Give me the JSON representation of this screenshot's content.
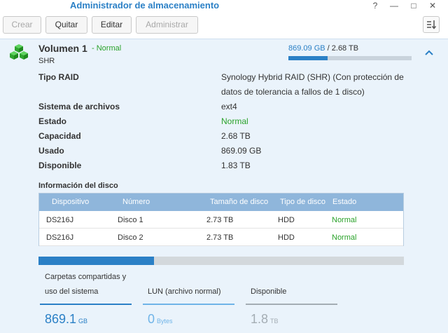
{
  "window": {
    "title": "Administrador de almacenamiento",
    "help_glyph": "?",
    "minimize_glyph": "—",
    "maximize_glyph": "□",
    "close_glyph": "✕"
  },
  "toolbar": {
    "create_label": "Crear",
    "remove_label": "Quitar",
    "edit_label": "Editar",
    "manage_label": "Administrar"
  },
  "volume": {
    "name": "Volumen 1",
    "status_text": "- Normal",
    "raid_short": "SHR",
    "used": "869.09 GB",
    "separator": " / ",
    "total": "2.68 TB",
    "used_fraction": 0.317
  },
  "properties": {
    "raid_label": "Tipo RAID",
    "raid_value_line1": "Synology Hybrid RAID (SHR) (Con protección de",
    "raid_value_line2": "datos de tolerancia a fallos de 1 disco)",
    "fs_label": "Sistema de archivos",
    "fs_value": "ext4",
    "status_label": "Estado",
    "status_value": "Normal",
    "capacity_label": "Capacidad",
    "capacity_value": "2.68 TB",
    "used_label": "Usado",
    "used_value": "869.09 GB",
    "available_label": "Disponible",
    "available_value": "1.83 TB"
  },
  "disk_info": {
    "heading": "Información del disco",
    "columns": [
      "Dispositivo",
      "Número",
      "Tamaño de disco",
      "Tipo de disco",
      "Estado"
    ],
    "rows": [
      [
        "DS216J",
        "Disco 1",
        "2.73 TB",
        "HDD",
        "Normal"
      ],
      [
        "DS216J",
        "Disco 2",
        "2.73 TB",
        "HDD",
        "Normal"
      ]
    ]
  },
  "capacity_bar": {
    "used_fraction": 0.317,
    "used_color": "#2b80c6",
    "free_color": "#d3d8dc"
  },
  "legend": {
    "shared": {
      "label_line1": "Carpetas compartidas y",
      "label_line2": "uso del sistema",
      "value": "869.1",
      "unit": "GB",
      "color": "#2b80c6"
    },
    "lun": {
      "label": "LUN (archivo normal)",
      "value": "0",
      "unit": "Bytes",
      "color": "#6fb4e8"
    },
    "available": {
      "label": "Disponible",
      "value": "1.8",
      "unit": "TB",
      "color": "#a4adb4"
    }
  }
}
